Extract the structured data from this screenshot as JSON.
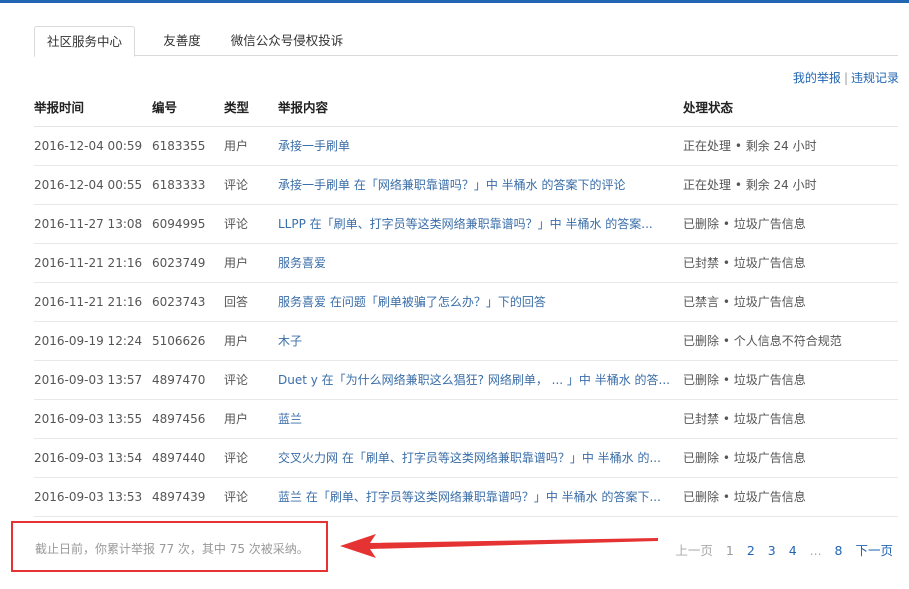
{
  "tabs": [
    "社区服务中心",
    "友善度",
    "微信公众号侵权投诉"
  ],
  "links": {
    "my_reports": "我的举报",
    "separator": "|",
    "violations": "违规记录"
  },
  "table": {
    "headers": [
      "举报时间",
      "编号",
      "类型",
      "举报内容",
      "处理状态"
    ],
    "rows": [
      [
        "2016-12-04 00:59",
        "6183355",
        "用户",
        "承接一手刷单",
        "正在处理 • 剩余 24 小时"
      ],
      [
        "2016-12-04 00:55",
        "6183333",
        "评论",
        "承接一手刷单 在「网络兼职靠谱吗？」中 半桶水 的答案下的评论",
        "正在处理 • 剩余 24 小时"
      ],
      [
        "2016-11-27 13:08",
        "6094995",
        "评论",
        "LLPP 在「刷单、打字员等这类网络兼职靠谱吗？」中 半桶水 的答案...",
        "已删除 • 垃圾广告信息"
      ],
      [
        "2016-11-21 21:16",
        "6023749",
        "用户",
        "服务喜爱",
        "已封禁 • 垃圾广告信息"
      ],
      [
        "2016-11-21 21:16",
        "6023743",
        "回答",
        "服务喜爱 在问题「刷单被骗了怎么办？」下的回答",
        "已禁言 • 垃圾广告信息"
      ],
      [
        "2016-09-19 12:24",
        "5106626",
        "用户",
        "木子",
        "已删除 • 个人信息不符合规范"
      ],
      [
        "2016-09-03 13:57",
        "4897470",
        "评论",
        "Duet y 在「为什么网络兼职这么猖狂? 网络刷单， ... 」中 半桶水 的答...",
        "已删除 • 垃圾广告信息"
      ],
      [
        "2016-09-03 13:55",
        "4897456",
        "用户",
        "蓝兰",
        "已封禁 • 垃圾广告信息"
      ],
      [
        "2016-09-03 13:54",
        "4897440",
        "评论",
        "交叉火力网 在「刷单、打字员等这类网络兼职靠谱吗？」中 半桶水 的...",
        "已删除 • 垃圾广告信息"
      ],
      [
        "2016-09-03 13:53",
        "4897439",
        "评论",
        "蓝兰 在「刷单、打字员等这类网络兼职靠谱吗？」中 半桶水 的答案下...",
        "已删除 • 垃圾广告信息"
      ]
    ]
  },
  "summary": "截止日前，你累计举报 77 次，其中 75 次被采纳。",
  "pager": {
    "prev": "上一页",
    "pages": [
      "1",
      "2",
      "3",
      "4"
    ],
    "dots": "...",
    "last": "8",
    "next": "下一页"
  },
  "colors": {
    "accent": "#2266b3",
    "link": "#3a6ea8",
    "annotation": "#e53333"
  }
}
